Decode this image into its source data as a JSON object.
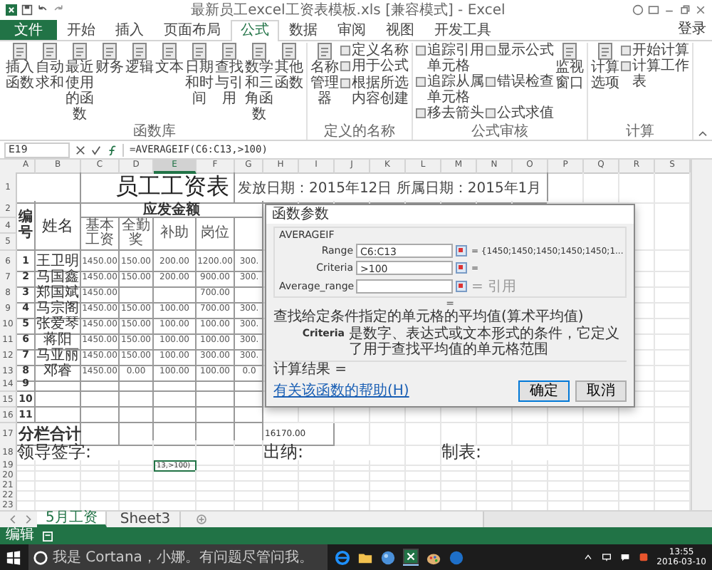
{
  "window": {
    "title": "最新员工excel工资表模板.xls [兼容模式] - Excel"
  },
  "tabs": [
    {
      "label": "文件",
      "selected": false,
      "kind": "file"
    },
    {
      "label": "开始",
      "selected": false,
      "kind": "tab"
    },
    {
      "label": "插入",
      "selected": false,
      "kind": "tab"
    },
    {
      "label": "页面布局",
      "selected": false,
      "kind": "tab"
    },
    {
      "label": "公式",
      "selected": true,
      "kind": "tab"
    },
    {
      "label": "数据",
      "selected": false,
      "kind": "tab"
    },
    {
      "label": "审阅",
      "selected": false,
      "kind": "tab"
    },
    {
      "label": "视图",
      "selected": false,
      "kind": "tab"
    },
    {
      "label": "开发工具",
      "selected": false,
      "kind": "tab"
    }
  ],
  "account": "登录",
  "ribbon": [
    {
      "label": "函数库",
      "items": [
        {
          "kind": "large",
          "label": "插入函数"
        },
        {
          "kind": "large",
          "label": "自动求和"
        },
        {
          "kind": "large",
          "label": "最近使用的函数"
        },
        {
          "kind": "large",
          "label": "财务"
        },
        {
          "kind": "large",
          "label": "逻辑"
        },
        {
          "kind": "large",
          "label": "文本"
        },
        {
          "kind": "large",
          "label": "日期和时间"
        },
        {
          "kind": "large",
          "label": "查找与引用"
        },
        {
          "kind": "large",
          "label": "数学和三角函数"
        },
        {
          "kind": "large",
          "label": "其他函数"
        }
      ]
    },
    {
      "label": "定义的名称",
      "items": [
        {
          "kind": "large",
          "label": "名称管理器"
        },
        {
          "kind": "small",
          "label": "定义名称"
        },
        {
          "kind": "small",
          "label": "用于公式"
        },
        {
          "kind": "small",
          "label": "根据所选内容创建"
        }
      ]
    },
    {
      "label": "公式审核",
      "items": [
        {
          "kind": "small",
          "label": "追踪引用单元格"
        },
        {
          "kind": "small",
          "label": "追踪从属单元格"
        },
        {
          "kind": "small",
          "label": "移去箭头"
        },
        {
          "kind": "small",
          "label": "显示公式"
        },
        {
          "kind": "small",
          "label": "错误检查"
        },
        {
          "kind": "small",
          "label": "公式求值"
        },
        {
          "kind": "large",
          "label": "监视窗口"
        }
      ]
    },
    {
      "label": "计算",
      "items": [
        {
          "kind": "large",
          "label": "计算选项"
        },
        {
          "kind": "small",
          "label": "开始计算"
        },
        {
          "kind": "small",
          "label": "计算工作表"
        }
      ]
    }
  ],
  "formula_bar": {
    "name_box": "E19",
    "formula": "=AVERAGEIF(C6:C13,>100)"
  },
  "columns": [
    {
      "label": "A",
      "selected": false
    },
    {
      "label": "B",
      "selected": false
    },
    {
      "label": "C",
      "selected": false
    },
    {
      "label": "D",
      "selected": false
    },
    {
      "label": "E",
      "selected": true
    },
    {
      "label": "F",
      "selected": false
    },
    {
      "label": "G",
      "selected": false
    },
    {
      "label": "H",
      "selected": false
    },
    {
      "label": "I",
      "selected": false
    },
    {
      "label": "J",
      "selected": false
    },
    {
      "label": "K",
      "selected": false
    },
    {
      "label": "L",
      "selected": false
    },
    {
      "label": "M",
      "selected": false
    },
    {
      "label": "N",
      "selected": false
    },
    {
      "label": "O",
      "selected": false
    },
    {
      "label": "P",
      "selected": false
    },
    {
      "label": "Q",
      "selected": false
    },
    {
      "label": "R",
      "selected": false
    },
    {
      "label": "S",
      "selected": false
    }
  ],
  "sheet": {
    "title_row": {
      "row": "1",
      "title": "员工工资表",
      "info": "发放日期：2015年12日 所属日期：2015年1月"
    },
    "header_rows": [
      "2",
      "4",
      "5"
    ],
    "header": {
      "number": "编号",
      "name": "姓名",
      "group": "应发金额",
      "basic_pay": "基本工资",
      "attendance_bonus": "全勤奖",
      "allowance": "补助",
      "post": "岗位"
    },
    "rows": [
      {
        "row": "6",
        "number": "1",
        "name": "王卫明",
        "basic_pay": "1450.00",
        "attendance_bonus": "150.00",
        "allowance": "200.00",
        "post": "1200.00",
        "column_5": "300."
      },
      {
        "row": "7",
        "number": "2",
        "name": "马国鑫",
        "basic_pay": "1450.00",
        "attendance_bonus": "150.00",
        "allowance": "200.00",
        "post": "900.00",
        "column_5": "300."
      },
      {
        "row": "8",
        "number": "3",
        "name": "郑国斌",
        "basic_pay": "1450.00",
        "post": "700.00"
      },
      {
        "row": "9",
        "number": "4",
        "name": "马宗阁",
        "basic_pay": "1450.00",
        "attendance_bonus": "150.00",
        "allowance": "100.00",
        "post": "700.00",
        "column_5": "300."
      },
      {
        "row": "10",
        "number": "5",
        "name": "张爱琴",
        "basic_pay": "1450.00",
        "attendance_bonus": "150.00",
        "allowance": "100.00",
        "post": "100.00",
        "column_5": "300."
      },
      {
        "row": "11",
        "number": "6",
        "name": "蒋阳",
        "basic_pay": "1450.00",
        "attendance_bonus": "150.00",
        "allowance": "100.00",
        "post": "100.00",
        "column_5": "300."
      },
      {
        "row": "12",
        "number": "7",
        "name": "马亚丽",
        "basic_pay": "1450.00",
        "attendance_bonus": "150.00",
        "allowance": "100.00",
        "post": "300.00",
        "column_5": "300."
      },
      {
        "row": "13",
        "number": "8",
        "name": "邓睿",
        "basic_pay": "1450.00",
        "attendance_bonus": "0.00",
        "allowance": "100.00",
        "post": "100.00",
        "column_5": "0.0"
      },
      {
        "row": "14",
        "number": "9"
      },
      {
        "row": "15",
        "number": "10"
      },
      {
        "row": "16",
        "number": "11"
      }
    ],
    "total_row": {
      "row": "17",
      "label": "分栏合计",
      "value": "16170.00"
    },
    "signature_row": {
      "row": "18",
      "items": [
        "领导签字:",
        "出纳:",
        "制表:"
      ]
    },
    "active_row": {
      "row": "19",
      "text": "13,>100)"
    },
    "blank_rows": [
      "20",
      "21",
      "22",
      "23"
    ]
  },
  "dialog": {
    "title": "函数参数",
    "function": "AVERAGEIF",
    "args": [
      {
        "label": "Range",
        "value": "C6:C13",
        "result": "= {1450;1450;1450;1450;1450;1...",
        "muted": false
      },
      {
        "label": "Criteria",
        "value": ">100",
        "result": "=",
        "muted": false
      },
      {
        "label": "Average_range",
        "result": "= 引用",
        "muted": true
      }
    ],
    "equals": "=",
    "description": "查找给定条件指定的单元格的平均值(算术平均值)",
    "arg_help": {
      "name": "Criteria",
      "text": "是数字、表达式或文本形式的条件，它定义了用于查找平均值的单元格范围"
    },
    "result_label": "计算结果 =",
    "help_link": "有关该函数的帮助(H)",
    "buttons": [
      {
        "label": "确定",
        "default": true
      },
      {
        "label": "取消",
        "default": false
      }
    ]
  },
  "sheet_tabs": [
    {
      "label": "5月工资",
      "selected": true
    },
    {
      "label": "Sheet3",
      "selected": false
    }
  ],
  "status_bar": {
    "mode": "编辑"
  },
  "taskbar": {
    "search": "我是 Cortana，小娜。有问题尽管问我。",
    "time": "13:55",
    "date": "2016-03-10"
  }
}
